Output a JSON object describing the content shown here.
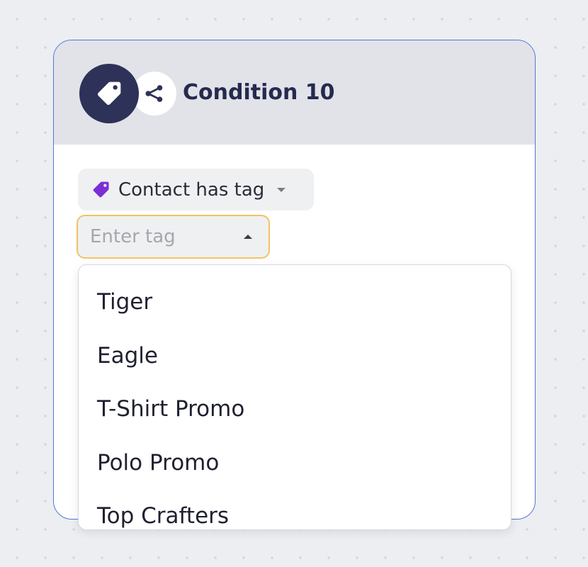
{
  "node": {
    "title": "Condition 10",
    "badge_icon": "tag-icon",
    "share_icon": "share-icon",
    "accent_border_color": "#5475d6",
    "header_background": "#e1e3e9"
  },
  "condition": {
    "label": "Contact has tag",
    "icon": "tag-icon",
    "icon_color": "#7b2fd6"
  },
  "tag_input": {
    "placeholder": "Enter tag",
    "focus_border_color": "#f1c462"
  },
  "dropdown": {
    "options": [
      "Tiger",
      "Eagle",
      "T-Shirt Promo",
      "Polo Promo",
      "Top Crafters"
    ]
  }
}
